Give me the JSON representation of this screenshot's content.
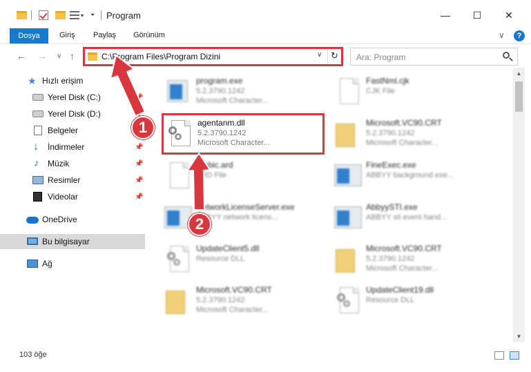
{
  "window": {
    "title": "Program",
    "minimize_glyph": "—",
    "maximize_glyph": "☐",
    "close_glyph": "✕"
  },
  "ribbon": {
    "tabs": [
      "Dosya",
      "Giriş",
      "Paylaş",
      "Görünüm"
    ],
    "expand_glyph": "∨",
    "help_glyph": "?"
  },
  "nav": {
    "back_glyph": "←",
    "forward_glyph": "→",
    "recent_glyph": "∨",
    "up_glyph": "↑",
    "address": "C:\\Program Files\\Program Dizini",
    "address_dropdown_glyph": "∨",
    "refresh_glyph": "↻",
    "search_placeholder": "Ara: Program"
  },
  "sidebar": {
    "items": [
      {
        "label": "Hızlı erişim",
        "icon": "star-icon"
      },
      {
        "label": "Yerel Disk (C:)",
        "icon": "disk-icon",
        "pinned": true
      },
      {
        "label": "Yerel Disk (D:)",
        "icon": "disk-icon",
        "pinned": true
      },
      {
        "label": "Belgeler",
        "icon": "document-icon",
        "pinned": true
      },
      {
        "label": "İndirmeler",
        "icon": "download-icon",
        "pinned": true
      },
      {
        "label": "Müzik",
        "icon": "music-icon",
        "pinned": true
      },
      {
        "label": "Resimler",
        "icon": "pictures-icon",
        "pinned": true
      },
      {
        "label": "Videolar",
        "icon": "videos-icon",
        "pinned": true
      },
      {
        "label": "OneDrive",
        "icon": "cloud-icon"
      },
      {
        "label": "Bu bilgisayar",
        "icon": "computer-icon",
        "selected": true
      },
      {
        "label": "Ağ",
        "icon": "network-icon"
      }
    ],
    "pin_glyph": "📌"
  },
  "files": [
    {
      "name": "program.exe",
      "l2": "5.2.3790.1242",
      "l3": "Microsoft Character...",
      "icon": "program-icon"
    },
    {
      "name": "FastNml.cjk",
      "l2": "CJK File",
      "l3": "",
      "icon": "file-icon"
    },
    {
      "name": "agentanm.dll",
      "l2": "5.2.3790.1242",
      "l3": "Microsoft Character...",
      "icon": "dll-gear-icon",
      "selected": true
    },
    {
      "name": "Microsoft.VC90.CRT",
      "l2": "5.2.3790.1242",
      "l3": "Microsoft Character...",
      "icon": "folder-file-icon"
    },
    {
      "name": "arabic.ard",
      "l2": "ARD File",
      "l3": "",
      "icon": "file-icon"
    },
    {
      "name": "FineExec.exe",
      "l2": "ABBYY background exe...",
      "l3": "",
      "icon": "app-window-icon"
    },
    {
      "name": "NetworkLicenseServer.exe",
      "l2": "ABBYY network licens...",
      "l3": "",
      "icon": "app-window-icon"
    },
    {
      "name": "AbbyySTI.exe",
      "l2": "ABBYY sti event hand...",
      "l3": "",
      "icon": "app-window-icon"
    },
    {
      "name": "UpdateClient5.dll",
      "l2": "Resource DLL",
      "l3": "",
      "icon": "dll-gear-icon"
    },
    {
      "name": "Microsoft.VC90.CRT",
      "l2": "5.2.3790.1242",
      "l3": "Microsoft Character...",
      "icon": "folder-file-icon"
    },
    {
      "name": "Microsoft.VC90.CRT",
      "l2": "5.2.3790.1242",
      "l3": "Microsoft Character...",
      "icon": "folder-file-icon"
    },
    {
      "name": "UpdateClient19.dll",
      "l2": "Resource DLL",
      "l3": "",
      "icon": "dll-gear-icon"
    }
  ],
  "status": {
    "count": "103 öğe"
  },
  "annotations": {
    "step1": "1",
    "step2": "2"
  },
  "colors": {
    "accent": "#1979ca",
    "highlight": "#d9363e"
  }
}
